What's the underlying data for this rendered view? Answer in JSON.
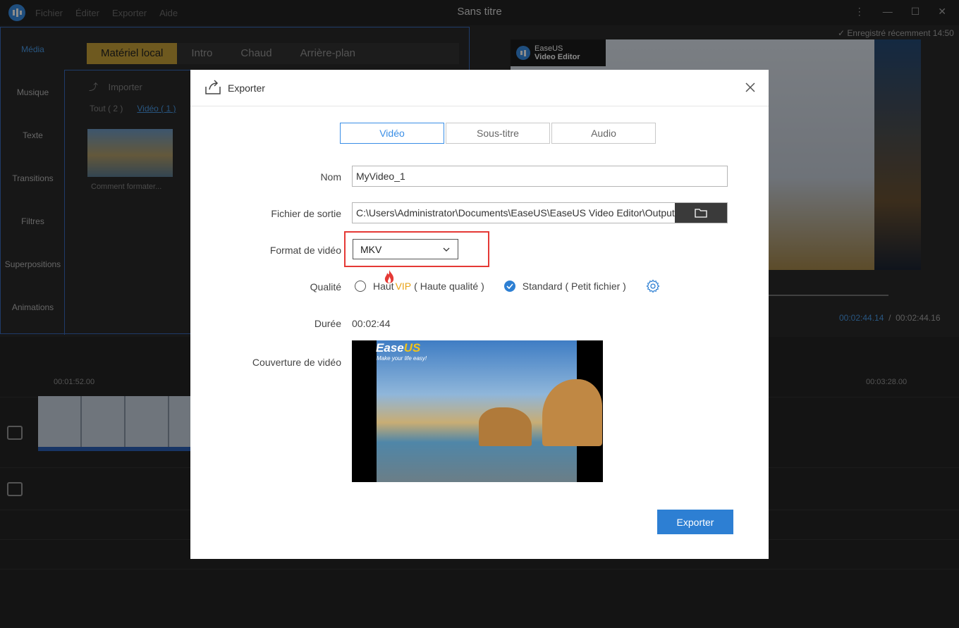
{
  "app": {
    "title": "Sans titre",
    "menu": [
      "Fichier",
      "Éditer",
      "Exporter",
      "Aide"
    ]
  },
  "sidebar": {
    "items": [
      "Média",
      "Musique",
      "Texte",
      "Transitions",
      "Filtres",
      "Superpositions",
      "Animations"
    ]
  },
  "media": {
    "tabs": [
      "Matériel local",
      "Intro",
      "Chaud",
      "Arrière-plan"
    ],
    "import_label": "Importer",
    "filter_all": "Tout ( 2 )",
    "filter_video": "Vidéo ( 1 )",
    "thumb_caption": "Comment formater..."
  },
  "preview": {
    "saved_status": "Enregistré récemment 14:50",
    "brand_line1": "EaseUS",
    "brand_line2": "Video Editor",
    "current_time": "00:02:44.14",
    "separator": "/",
    "total_time": "00:02:44.16"
  },
  "timeline": {
    "tick_left": "00:01:52.00",
    "tick_right": "00:03:28.00"
  },
  "dialog": {
    "title": "Exporter",
    "tabs": [
      "Vidéo",
      "Sous-titre",
      "Audio"
    ],
    "name_label": "Nom",
    "name_value": "MyVideo_1",
    "output_label": "Fichier de sortie",
    "output_value": "C:\\Users\\Administrator\\Documents\\EaseUS\\EaseUS Video Editor\\Output",
    "format_label": "Format de vidéo",
    "format_value": "MKV",
    "quality_label": "Qualité",
    "quality_high": "Haut",
    "quality_vip": "VIP",
    "quality_high_desc": "( Haute qualité )",
    "quality_standard": "Standard ( Petit fichier )",
    "duration_label": "Durée",
    "duration_value": "00:02:44",
    "cover_label": "Couverture de vidéo",
    "cover_brand_ease": "Ease",
    "cover_brand_us": "US",
    "cover_tagline": "Make your life easy!",
    "export_button": "Exporter"
  },
  "colors": {
    "accent": "#2d7fd3",
    "highlight_box": "#e53935",
    "vip": "#e8a317",
    "tab_active_bg": "#c8a33a"
  }
}
